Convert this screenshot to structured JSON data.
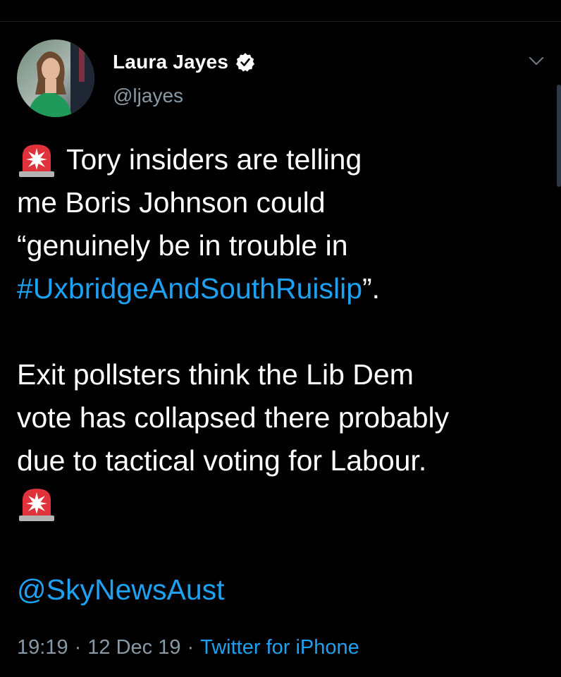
{
  "user": {
    "display_name": "Laura Jayes",
    "handle": "@ljayes",
    "verified": true,
    "avatar_icon": "profile-photo"
  },
  "tweet": {
    "line1": "Tory insiders are telling",
    "line2": "me Boris Johnson could",
    "line3": "“genuinely be in trouble in",
    "hashtag": "#UxbridgeAndSouthRuislip",
    "hashtag_tail": "”.",
    "line5": "Exit pollsters think the Lib Dem",
    "line6": "vote has collapsed there probably",
    "line7": "due to tactical voting for Labour.",
    "mention": "@SkyNewsAust",
    "emoji": "police-car-light-emoji"
  },
  "meta": {
    "time": "19:19",
    "date": "12 Dec 19",
    "separator": "·",
    "source": "Twitter for iPhone"
  },
  "colors": {
    "background": "#000000",
    "text": "#ffffff",
    "secondary": "#8899a6",
    "link": "#1da1f2"
  }
}
